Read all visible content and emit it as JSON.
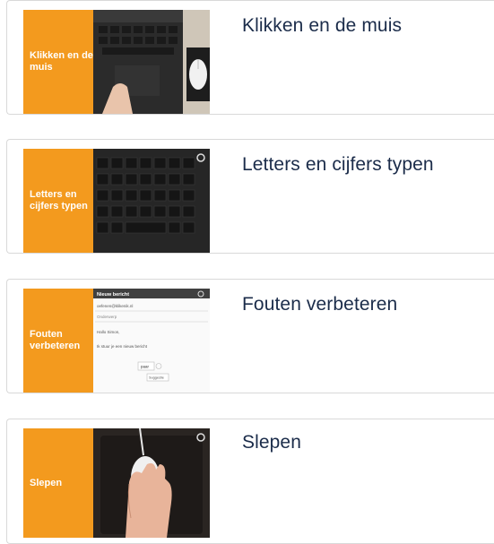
{
  "lessons": [
    {
      "thumb_label": "Klikken en de muis",
      "title": "Klikken en de muis"
    },
    {
      "thumb_label": "Letters en cijfers typen",
      "title": "Letters en cijfers typen"
    },
    {
      "thumb_label": "Fouten verbeteren",
      "title": "Fouten verbeteren"
    },
    {
      "thumb_label": "Slepen",
      "title": "Slepen"
    }
  ],
  "email_preview": {
    "header": "Nieuw bericht",
    "to": "oefenen@klikenik.nl",
    "subject": "Onderwerp",
    "greeting": "Hallo Simon,",
    "body": "Ik stuur je een nieuw bericht",
    "popup_word": "paar",
    "popup_hint": "Suggestie"
  },
  "colors": {
    "accent": "#f39a1e",
    "title": "#1b2c4a"
  }
}
